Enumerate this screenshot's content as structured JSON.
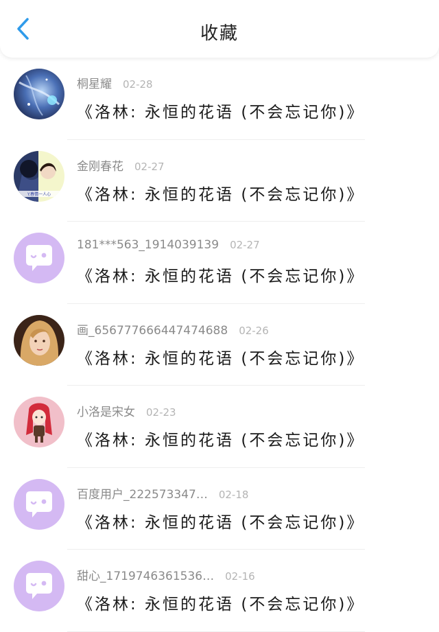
{
  "header": {
    "title": "收藏",
    "back_icon": "chevron-left-icon"
  },
  "colors": {
    "accent": "#2f9bea",
    "default_avatar_bg": "#d4b9f3"
  },
  "items": [
    {
      "username": "桐星耀",
      "date": "02-28",
      "content": "《洛林: 永恒的花语 (不会忘记你)》",
      "avatar": "galaxy-avatar"
    },
    {
      "username": "金刚春花",
      "date": "02-27",
      "content": "《洛林: 永恒的花语 (不会忘记你)》",
      "avatar": "couple-avatar"
    },
    {
      "username": "181***563_1914039139",
      "date": "02-27",
      "content": "《洛林: 永恒的花语 (不会忘记你)》",
      "avatar": "default-avatar"
    },
    {
      "username": "画_656777666447474688",
      "date": "02-26",
      "content": "《洛林: 永恒的花语 (不会忘记你)》",
      "avatar": "portrait-avatar"
    },
    {
      "username": "小洛是宋女",
      "date": "02-23",
      "content": "《洛林: 永恒的花语 (不会忘记你)》",
      "avatar": "cartoon-girl-avatar"
    },
    {
      "username": "百度用户_222573347…",
      "date": "02-18",
      "content": "《洛林: 永恒的花语 (不会忘记你)》",
      "avatar": "default-avatar"
    },
    {
      "username": "甜心_1719746361536…",
      "date": "02-16",
      "content": "《洛林: 永恒的花语 (不会忘记你)》",
      "avatar": "default-avatar"
    }
  ]
}
